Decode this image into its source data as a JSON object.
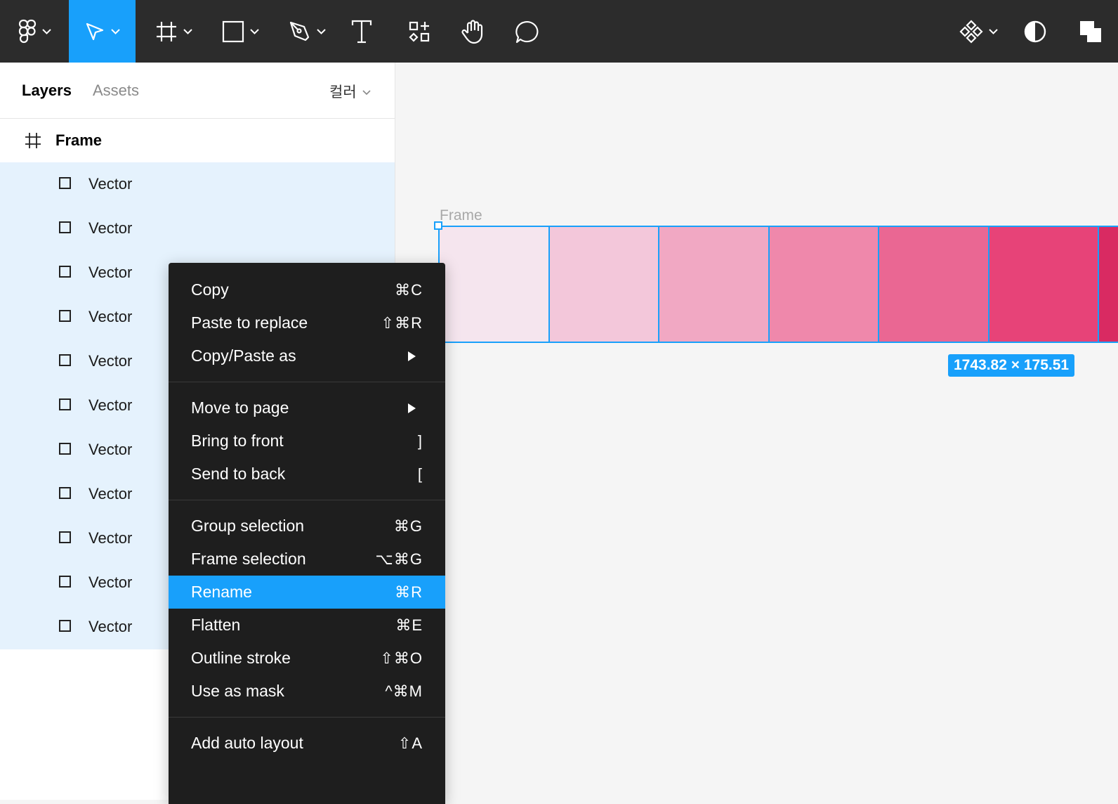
{
  "toolbar": {
    "tools": [
      {
        "name": "main-menu",
        "icon": "figma-logo-icon",
        "has_caret": true
      },
      {
        "name": "move",
        "icon": "move-cursor-icon",
        "has_caret": true,
        "active": true
      },
      {
        "name": "frame",
        "icon": "frame-hash-icon",
        "has_caret": true
      },
      {
        "name": "shape",
        "icon": "rectangle-icon",
        "has_caret": true
      },
      {
        "name": "pen",
        "icon": "pen-icon",
        "has_caret": true
      },
      {
        "name": "text",
        "icon": "text-icon",
        "has_caret": false
      },
      {
        "name": "resources",
        "icon": "resources-icon",
        "has_caret": false
      },
      {
        "name": "hand",
        "icon": "hand-icon",
        "has_caret": false
      },
      {
        "name": "comment",
        "icon": "comment-icon",
        "has_caret": false
      },
      {
        "name": "components",
        "icon": "component-icon",
        "has_caret": true
      },
      {
        "name": "contrast",
        "icon": "contrast-icon",
        "has_caret": false
      },
      {
        "name": "multiplayer",
        "icon": "layers-stack-icon",
        "has_caret": false
      }
    ],
    "accent_color": "#18a0fb"
  },
  "left_panel": {
    "tabs": {
      "layers": "Layers",
      "assets": "Assets"
    },
    "page_select": "컬러",
    "frame_label": "Frame",
    "layers": [
      {
        "label": "Vector"
      },
      {
        "label": "Vector"
      },
      {
        "label": "Vector"
      },
      {
        "label": "Vector"
      },
      {
        "label": "Vector"
      },
      {
        "label": "Vector"
      },
      {
        "label": "Vector"
      },
      {
        "label": "Vector"
      },
      {
        "label": "Vector"
      },
      {
        "label": "Vector"
      },
      {
        "label": "Vector"
      }
    ]
  },
  "canvas": {
    "frame_title": "Frame",
    "size_badge": "1743.82 × 175.51",
    "swatch_colors": [
      "#f5e5ee",
      "#f3c7da",
      "#f1a8c3",
      "#ef88ab",
      "#ea6793",
      "#e74378",
      "#d92a62"
    ]
  },
  "context_menu": {
    "sections": [
      {
        "items": [
          {
            "label": "Copy",
            "shortcut": "⌘C"
          },
          {
            "label": "Paste to replace",
            "shortcut": "⇧⌘R"
          },
          {
            "label": "Copy/Paste as",
            "submenu": true
          }
        ]
      },
      {
        "items": [
          {
            "label": "Move to page",
            "submenu": true
          },
          {
            "label": "Bring to front",
            "shortcut": "]"
          },
          {
            "label": "Send to back",
            "shortcut": "["
          }
        ]
      },
      {
        "items": [
          {
            "label": "Group selection",
            "shortcut": "⌘G"
          },
          {
            "label": "Frame selection",
            "shortcut": "⌥⌘G"
          },
          {
            "label": "Rename",
            "shortcut": "⌘R",
            "highlighted": true
          },
          {
            "label": "Flatten",
            "shortcut": "⌘E"
          },
          {
            "label": "Outline stroke",
            "shortcut": "⇧⌘O"
          },
          {
            "label": "Use as mask",
            "shortcut": "^⌘M"
          }
        ]
      },
      {
        "items": [
          {
            "label": "Add auto layout",
            "shortcut": "⇧A"
          }
        ]
      }
    ]
  }
}
